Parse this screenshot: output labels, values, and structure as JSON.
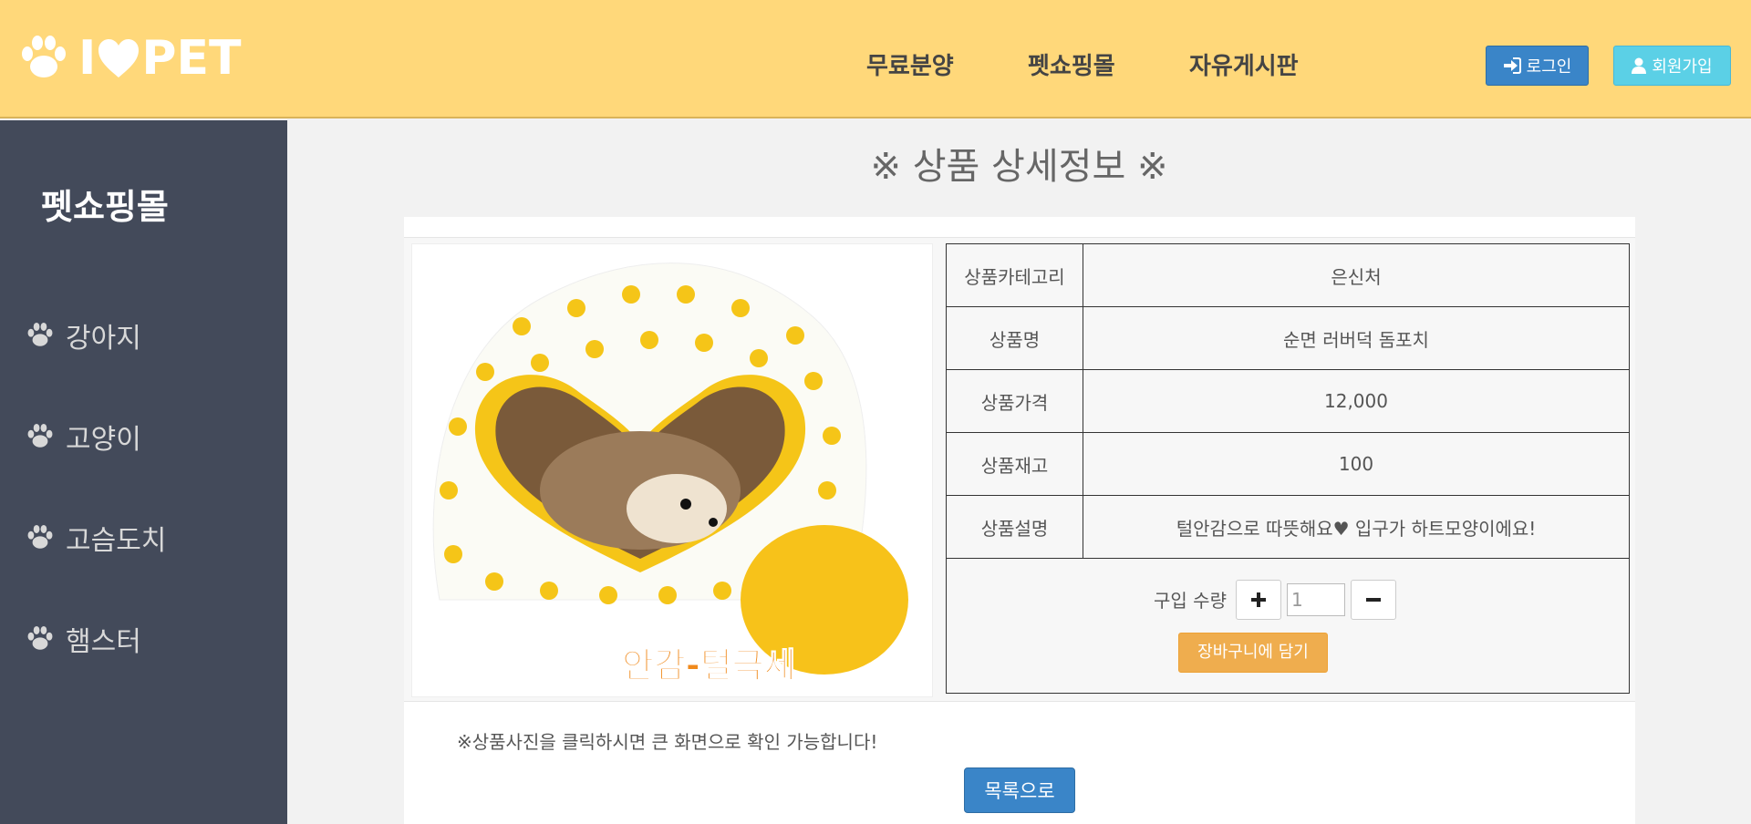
{
  "header": {
    "logo": {
      "left": "I",
      "right": "PET"
    },
    "nav": [
      {
        "label": "무료분양"
      },
      {
        "label": "펫쇼핑몰"
      },
      {
        "label": "자유게시판"
      }
    ],
    "login_label": "로그인",
    "join_label": "회원가입",
    "colors": {
      "background": "#ffd87a",
      "login": "#3a85c8",
      "join": "#5bd0e6"
    }
  },
  "sidebar": {
    "title": "펫쇼핑몰",
    "items": [
      {
        "label": "강아지",
        "icon": "paw-icon"
      },
      {
        "label": "고양이",
        "icon": "paw-icon"
      },
      {
        "label": "고슴도치",
        "icon": "paw-icon"
      },
      {
        "label": "햄스터",
        "icon": "paw-icon"
      }
    ]
  },
  "main": {
    "title": "※ 상품 상세정보 ※",
    "product_image": {
      "caption": "안감-털극세"
    },
    "details": [
      {
        "label": "상품카테고리",
        "value": "은신처"
      },
      {
        "label": "상품명",
        "value": "순면 러버덕 돔포치"
      },
      {
        "label": "상품가격",
        "value": "12,000"
      },
      {
        "label": "상품재고",
        "value": "100"
      },
      {
        "label": "상품설명",
        "value": "털안감으로 따뜻해요♥ 입구가 하트모양이에요!"
      }
    ],
    "quantity": {
      "label": "구입 수량",
      "value": "1"
    },
    "cart_label": "장바구니에 담기",
    "note": "※상품사진을 클릭하시면 큰 화면으로 확인 가능합니다!",
    "list_label": "목록으로"
  }
}
